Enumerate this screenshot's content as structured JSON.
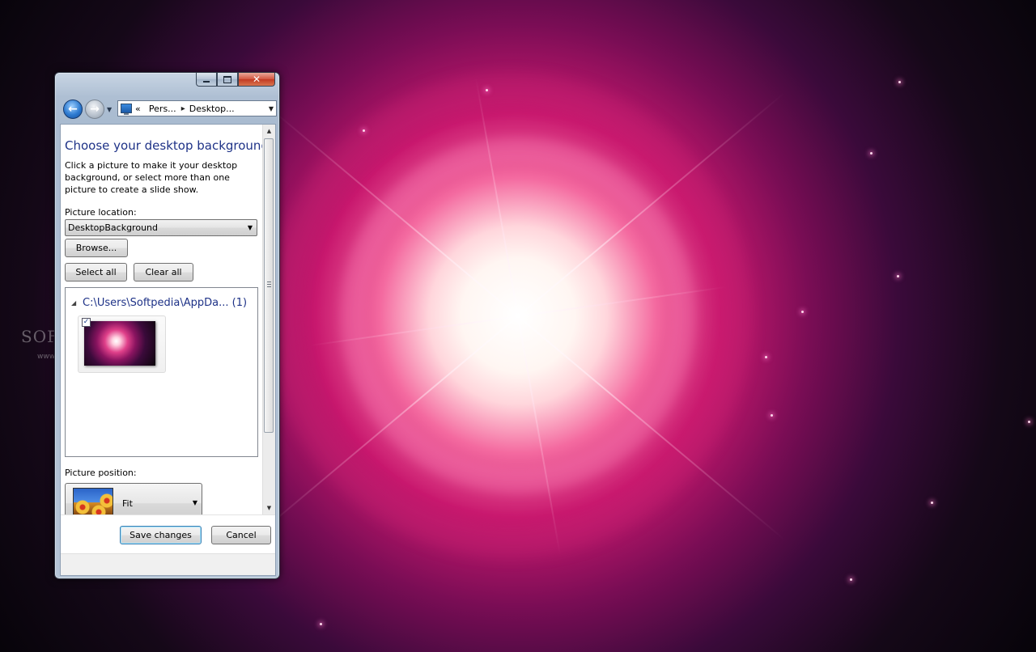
{
  "window": {
    "caption_buttons": {
      "minimize_icon": "minimize-icon",
      "maximize_icon": "maximize-icon",
      "close_glyph": "✕"
    }
  },
  "navigation": {
    "back_icon": "back-arrow-icon",
    "forward_icon": "forward-arrow-icon",
    "address": {
      "overflow_glyph": "«",
      "separator": "▸",
      "crumbs": [
        "Pers...",
        "Desktop..."
      ]
    }
  },
  "main": {
    "title": "Choose your desktop background",
    "instruction": "Click a picture to make it your desktop background, or select more than one picture to create a slide show.",
    "picture_location": {
      "label": "Picture location:",
      "selected": "DesktopBackground"
    },
    "browse_label": "Browse...",
    "select_all_label": "Select all",
    "clear_all_label": "Clear all",
    "picture_list": {
      "group_header": "C:\\Users\\Softpedia\\AppDa... (1)",
      "items": [
        {
          "checked": true,
          "check_glyph": "✓"
        }
      ]
    },
    "picture_position": {
      "label": "Picture position:",
      "selected": "Fit"
    }
  },
  "footer": {
    "save_label": "Save changes",
    "cancel_label": "Cancel"
  },
  "desktop": {
    "watermark": "SOFTPEDIA",
    "watermark_url": "www.softpedia.com"
  },
  "colors": {
    "title_blue": "#1e3287",
    "wallpaper_core": "#ffffff",
    "wallpaper_magenta": "#c8186e"
  }
}
